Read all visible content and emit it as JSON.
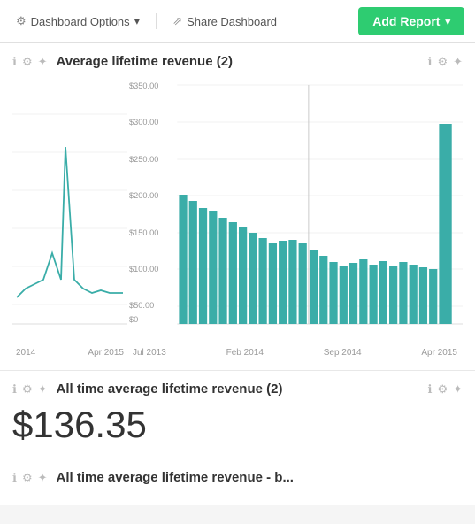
{
  "toolbar": {
    "dashboard_options_label": "Dashboard Options",
    "share_dashboard_label": "Share Dashboard",
    "add_report_label": "Add Report"
  },
  "chart_card": {
    "title": "Average lifetime revenue (2)",
    "left_xaxis": [
      "2014",
      "Apr 2015"
    ],
    "right_xaxis": [
      "Jul 2013",
      "Feb 2014",
      "Sep 2014",
      "Apr 2015"
    ],
    "y_labels": [
      "$350.00",
      "$300.00",
      "$250.00",
      "$200.00",
      "$150.00",
      "$100.00",
      "$50.00",
      "$0"
    ]
  },
  "metric_card": {
    "title": "All time average lifetime revenue (2)",
    "value": "$136.35"
  },
  "bottom_card": {
    "title": "All time average lifetime revenue - b..."
  },
  "icons": {
    "info": "ℹ",
    "filter": "⚙",
    "gear": "⚙",
    "share": "⇗",
    "chevron_down": "▾",
    "people": "⚙"
  }
}
